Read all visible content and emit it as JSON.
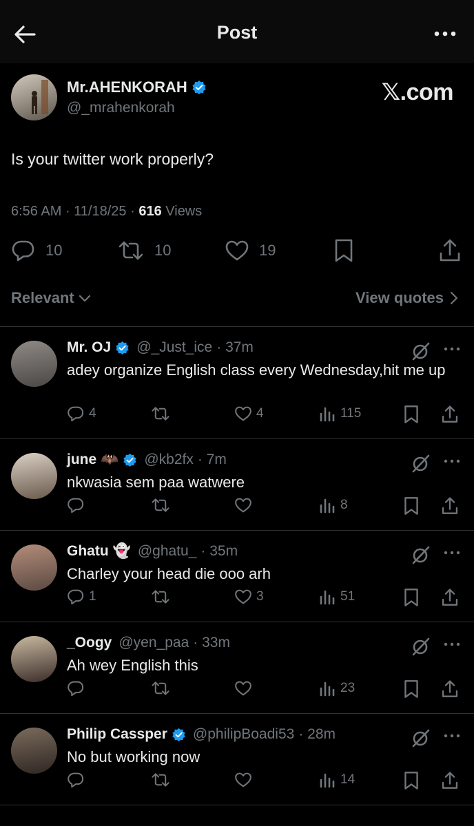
{
  "header": {
    "title": "Post",
    "back_icon": "arrow-left-icon",
    "more_icon": "more-horizontal-icon"
  },
  "post": {
    "author_name": "Mr.AHENKORAH",
    "author_handle": "@_mrahenkorah",
    "watermark": "𝕏.com",
    "text": "Is your twitter work properly?",
    "time": "6:56 AM",
    "date": "11/18/25",
    "views_count": "616",
    "views_label": "Views",
    "reply_count": "10",
    "repost_count": "10",
    "like_count": "19"
  },
  "sort": {
    "relevant_label": "Relevant",
    "view_quotes_label": "View quotes"
  },
  "colors": {
    "verified": "#1d9bf0",
    "muted": "#71767b",
    "text": "#e7e9ea",
    "divider": "#2f3336"
  },
  "replies": [
    {
      "name": "Mr. OJ",
      "emoji": "",
      "verified": true,
      "handle": "@_Just_ice",
      "time": "· 37m",
      "text": "adey organize English class every Wednesday,hit me up",
      "replies": "4",
      "reposts": "",
      "likes": "4",
      "views": "115"
    },
    {
      "name": "june",
      "emoji": "🦇",
      "verified": true,
      "handle": "@kb2fx",
      "time": "· 7m",
      "text": "nkwasia sem paa watwere",
      "replies": "",
      "reposts": "",
      "likes": "",
      "views": "8"
    },
    {
      "name": "Ghatu",
      "emoji": "👻",
      "verified": false,
      "handle": "@ghatu_",
      "time": "· 35m",
      "text": "Charley your head die ooo arh",
      "replies": "1",
      "reposts": "",
      "likes": "3",
      "views": "51"
    },
    {
      "name": "_Oogy",
      "emoji": "",
      "verified": false,
      "handle": "@yen_paa",
      "time": "· 33m",
      "text": "Ah wey English this",
      "replies": "",
      "reposts": "",
      "likes": "",
      "views": "23"
    },
    {
      "name": "Philip Cassper",
      "emoji": "",
      "verified": true,
      "handle": "@philipBoadi53",
      "time": "· 28m",
      "text": "No but working now",
      "replies": "",
      "reposts": "",
      "likes": "",
      "views": "14"
    }
  ]
}
